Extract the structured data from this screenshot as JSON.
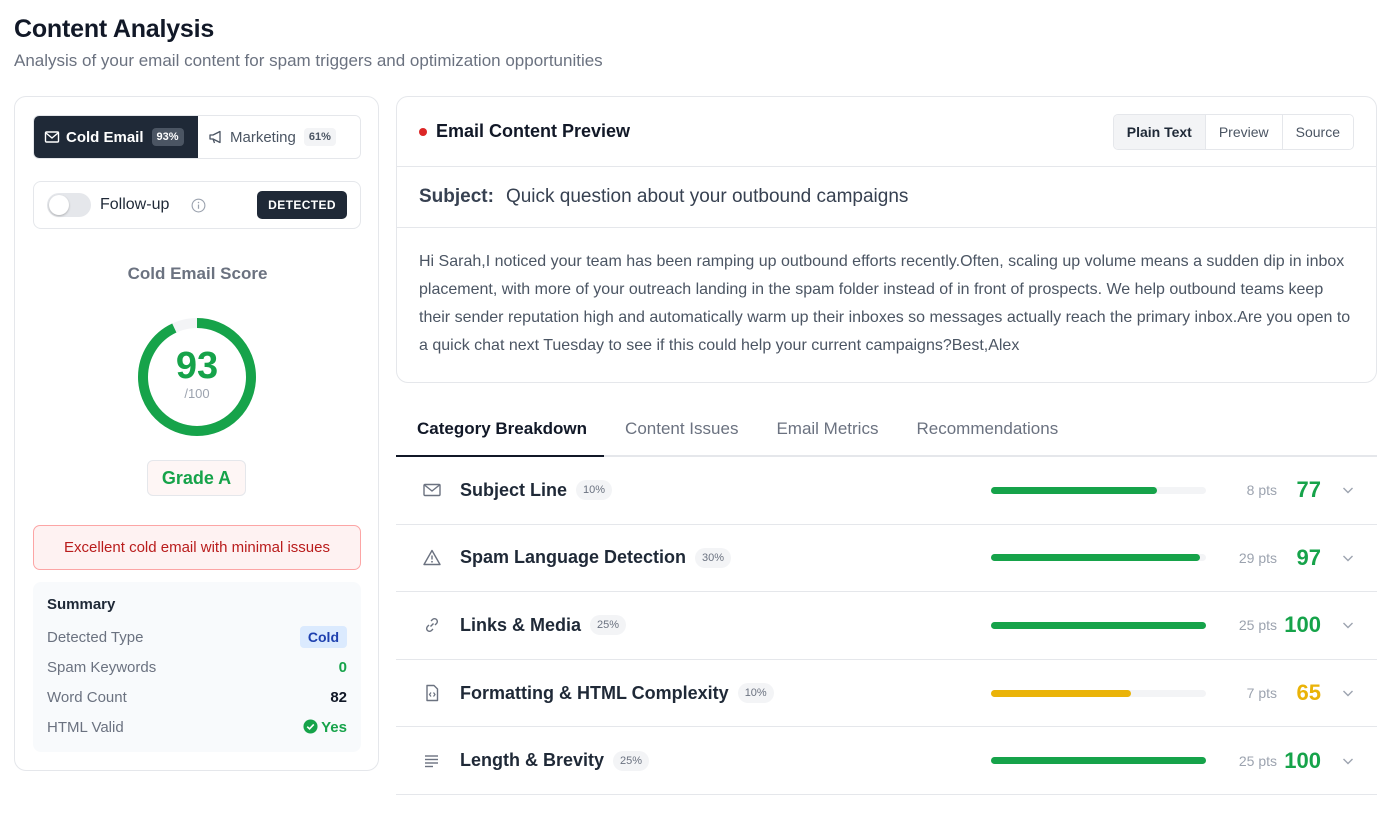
{
  "header": {
    "title": "Content Analysis",
    "subtitle": "Analysis of your email content for spam triggers and optimization opportunities"
  },
  "email_type": {
    "cold": {
      "label": "Cold Email",
      "pct": "93%"
    },
    "marketing": {
      "label": "Marketing",
      "pct": "61%"
    }
  },
  "followup": {
    "label": "Follow-up",
    "badge": "DETECTED"
  },
  "score": {
    "title": "Cold Email Score",
    "value": "93",
    "value_num": 93,
    "max": "/100",
    "grade": "Grade A",
    "color": "#16a34a"
  },
  "alert": "Excellent cold email with minimal issues",
  "summary": {
    "title": "Summary",
    "rows": [
      {
        "label": "Detected Type",
        "value": "Cold"
      },
      {
        "label": "Spam Keywords",
        "value": "0"
      },
      {
        "label": "Word Count",
        "value": "82"
      },
      {
        "label": "HTML Valid",
        "value": "Yes"
      }
    ]
  },
  "preview": {
    "title": "Email Content Preview",
    "views": [
      "Plain Text",
      "Preview",
      "Source"
    ],
    "subject_label": "Subject:",
    "subject": "Quick question about your outbound campaigns",
    "body": "Hi Sarah,I noticed your team has been ramping up outbound efforts recently.Often, scaling up volume means a sudden dip in inbox placement, with more of your outreach landing in the spam folder instead of in front of prospects. We help outbound teams keep their sender reputation high and automatically warm up their inboxes so messages actually reach the primary inbox.Are you open to a quick chat next Tuesday to see if this could help your current campaigns?Best,Alex"
  },
  "tabs": [
    "Category Breakdown",
    "Content Issues",
    "Email Metrics",
    "Recommendations"
  ],
  "categories": [
    {
      "name": "Subject Line",
      "weight": "10%",
      "pts": "8 pts",
      "score": "77",
      "fill": 0.77,
      "color": "#16a34a",
      "icon": "envelope-icon"
    },
    {
      "name": "Spam Language Detection",
      "weight": "30%",
      "pts": "29 pts",
      "score": "97",
      "fill": 0.97,
      "color": "#16a34a",
      "icon": "warning-icon"
    },
    {
      "name": "Links & Media",
      "weight": "25%",
      "pts": "25 pts",
      "score": "100",
      "fill": 1.0,
      "color": "#16a34a",
      "icon": "link-icon"
    },
    {
      "name": "Formatting & HTML Complexity",
      "weight": "10%",
      "pts": "7 pts",
      "score": "65",
      "fill": 0.65,
      "color": "#eab308",
      "icon": "code-file-icon"
    },
    {
      "name": "Length & Brevity",
      "weight": "25%",
      "pts": "25 pts",
      "score": "100",
      "fill": 1.0,
      "color": "#16a34a",
      "icon": "text-lines-icon"
    }
  ]
}
